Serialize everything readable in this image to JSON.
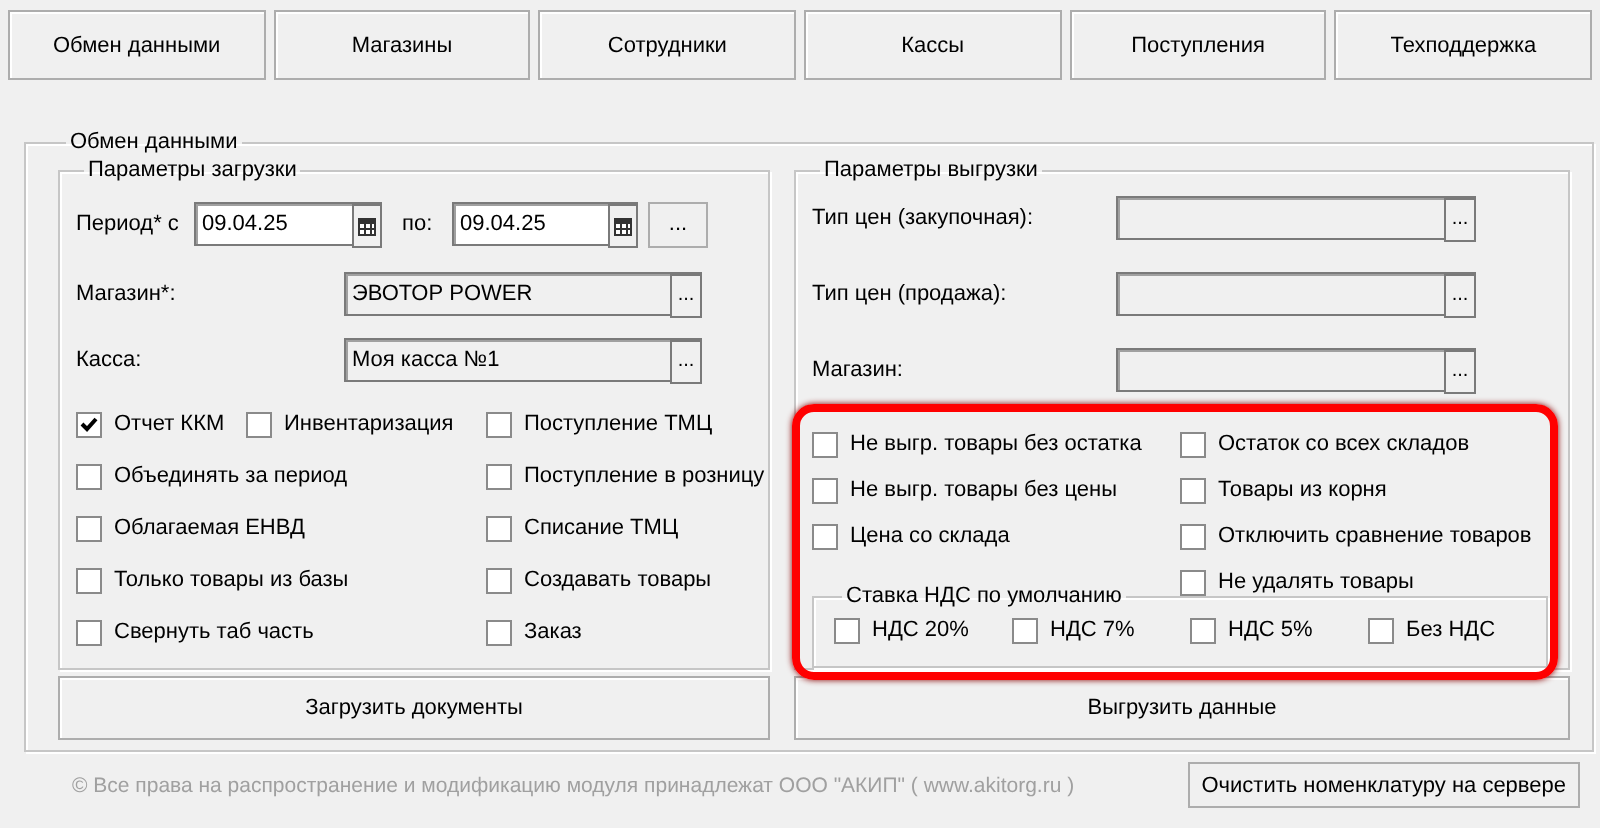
{
  "tabs": [
    {
      "label": "Обмен данными"
    },
    {
      "label": "Магазины"
    },
    {
      "label": "Сотрудники"
    },
    {
      "label": "Кассы"
    },
    {
      "label": "Поступления"
    },
    {
      "label": "Техподдержка"
    }
  ],
  "exchange": {
    "title": "Обмен данными",
    "import": {
      "title": "Параметры загрузки",
      "period": {
        "label": "Период* с",
        "from": "09.04.25",
        "to_label": "по:",
        "to": "09.04.25",
        "more": "..."
      },
      "fields": [
        {
          "label": "Магазин*:",
          "value": "ЭВОТОР POWER",
          "more": "..."
        },
        {
          "label": "Касса:",
          "value": "Моя касса №1",
          "more": "..."
        }
      ],
      "checks_left": [
        {
          "label": "Отчет ККМ",
          "checked": true,
          "beside": {
            "label": "Инвентаризация",
            "checked": false
          }
        },
        {
          "label": "Объединять за период",
          "checked": false
        },
        {
          "label": "Облагаемая ЕНВД",
          "checked": false
        },
        {
          "label": "Только товары из базы",
          "checked": false
        },
        {
          "label": "Свернуть таб часть",
          "checked": false
        }
      ],
      "checks_right": [
        {
          "label": "Поступление ТМЦ",
          "checked": false
        },
        {
          "label": "Поступление в розницу",
          "checked": false
        },
        {
          "label": "Списание ТМЦ",
          "checked": false
        },
        {
          "label": "Создавать товары",
          "checked": false
        },
        {
          "label": "Заказ",
          "checked": false
        }
      ],
      "button": "Загрузить документы"
    },
    "export": {
      "title": "Параметры выгрузки",
      "fields": [
        {
          "label": "Тип цен (закупочная):",
          "more": "..."
        },
        {
          "label": "Тип цен (продажа):",
          "more": "..."
        },
        {
          "label": "Магазин:",
          "more": "..."
        }
      ],
      "checks_left": [
        {
          "label": "Не выгр. товары без остатка",
          "checked": false
        },
        {
          "label": "Не выгр. товары без цены",
          "checked": false
        },
        {
          "label": "Цена со склада",
          "checked": false
        }
      ],
      "checks_right": [
        {
          "label": "Остаток со всех складов",
          "checked": false
        },
        {
          "label": "Товары из корня",
          "checked": false
        },
        {
          "label": "Отключить сравнение товаров",
          "checked": false
        },
        {
          "label": "Не удалять товары",
          "checked": false
        }
      ],
      "vat": {
        "title": "Ставка НДС по умолчанию",
        "options": [
          {
            "label": "НДС 20%",
            "checked": false
          },
          {
            "label": "НДС 7%",
            "checked": false
          },
          {
            "label": "НДС 5%",
            "checked": false
          },
          {
            "label": "Без НДС",
            "checked": false
          }
        ]
      },
      "highlighted": true,
      "button": "Выгрузить данные"
    }
  },
  "footer": {
    "copyright": "© Все права на распространение и модификацию модуля принадлежат ООО \"АКИП\" ( www.akitorg.ru )",
    "button": "Очистить номенклатуру на сервере"
  }
}
